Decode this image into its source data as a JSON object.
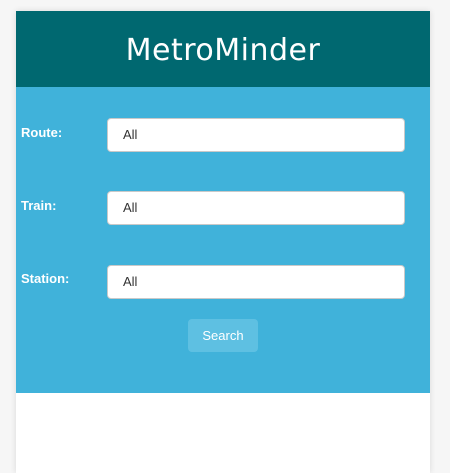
{
  "header": {
    "title": "MetroMinder"
  },
  "form": {
    "route": {
      "label": "Route:",
      "value": "All"
    },
    "train": {
      "label": "Train:",
      "value": "All"
    },
    "station": {
      "label": "Station:",
      "value": "All"
    },
    "search_label": "Search"
  },
  "colors": {
    "header_bg": "#006870",
    "panel_bg": "#40b2da",
    "button_bg": "#5ec0e2"
  }
}
